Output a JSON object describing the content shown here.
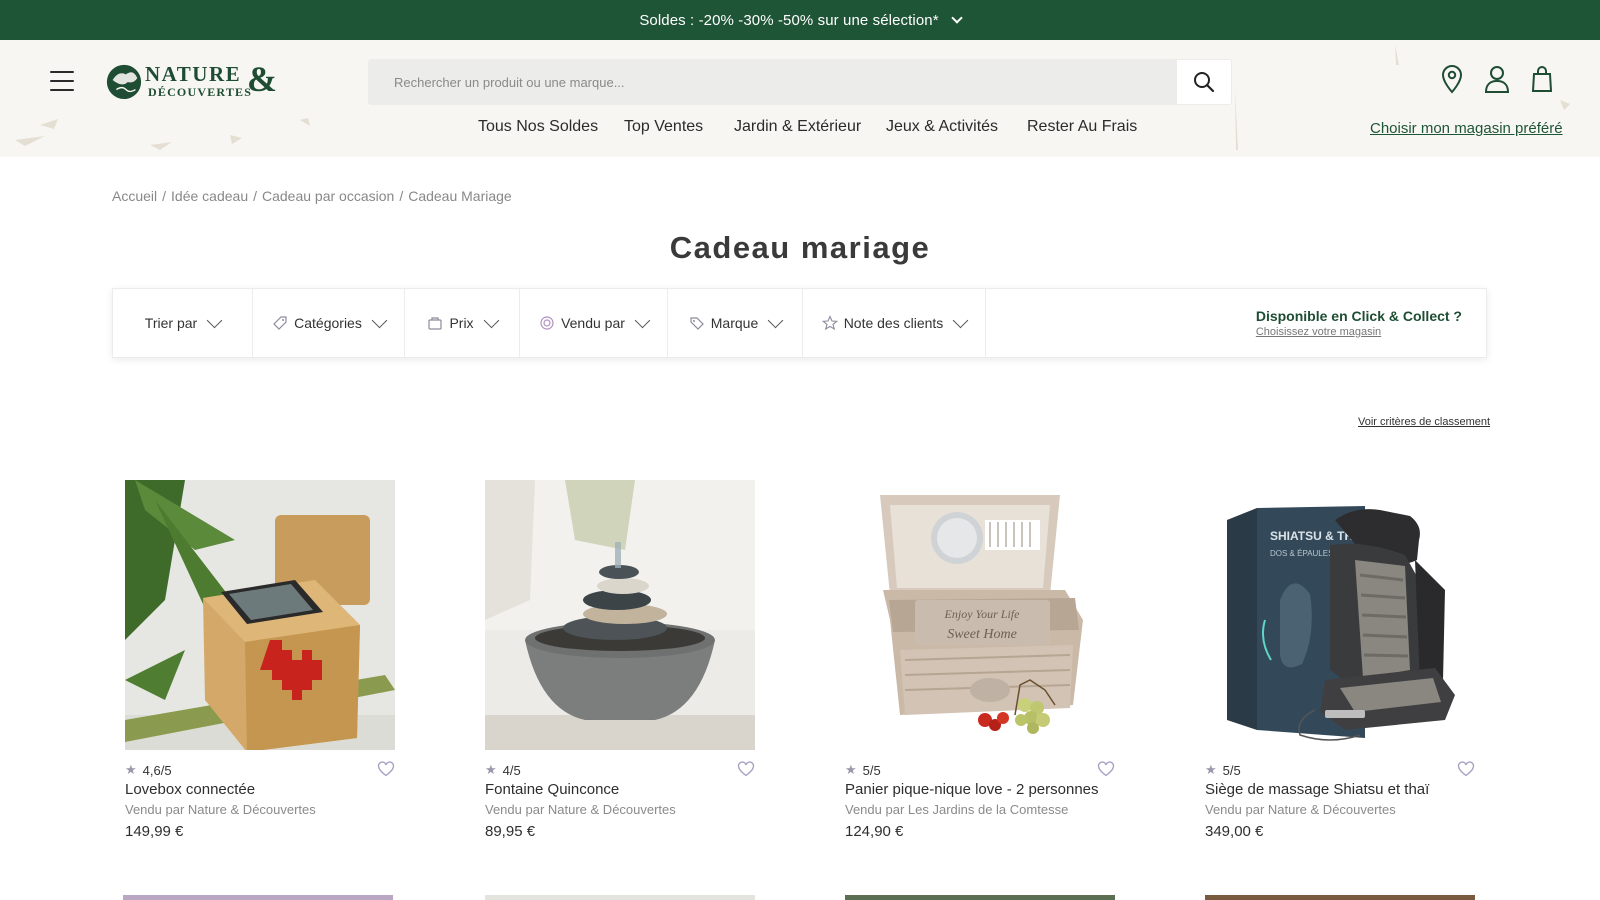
{
  "promo": {
    "text": "Soldes : -20% -30% -50% sur une sélection*"
  },
  "header": {
    "logo": {
      "line1": "NATURE",
      "line2": "DÉCOUVERTES",
      "amp": "&"
    },
    "search": {
      "placeholder": "Rechercher un produit ou une marque..."
    },
    "nav": [
      "Tous Nos Soldes",
      "Top Ventes",
      "Jardin & Extérieur",
      "Jeux & Activités",
      "Rester Au Frais"
    ],
    "icons": [
      "location-pin-icon",
      "account-icon",
      "cart-bag-icon"
    ],
    "store_link": "Choisir mon magasin préféré"
  },
  "breadcrumb": {
    "items": [
      "Accueil",
      "Idée cadeau",
      "Cadeau par occasion"
    ],
    "current": "Cadeau Mariage",
    "separator": "/"
  },
  "page": {
    "title": "Cadeau mariage"
  },
  "filters": {
    "items": [
      {
        "label": "Trier par",
        "icon": ""
      },
      {
        "label": "Catégories",
        "icon": "tag-icon"
      },
      {
        "label": "Prix",
        "icon": "price-bag-icon"
      },
      {
        "label": "Vendu par",
        "icon": "seller-icon"
      },
      {
        "label": "Marque",
        "icon": "label-icon"
      },
      {
        "label": "Note des clients",
        "icon": "star-outline-icon"
      }
    ],
    "click_collect": {
      "title": "Disponible en Click & Collect ?",
      "link": "Choisissez votre magasin"
    }
  },
  "criteria_link": "Voir critères de classement",
  "products": [
    {
      "rating": "4,6/5",
      "name": "Lovebox connectée",
      "seller": "Vendu par Nature & Découvertes",
      "price": "149,99 €"
    },
    {
      "rating": "4/5",
      "name": "Fontaine Quinconce",
      "seller": "Vendu par Nature & Découvertes",
      "price": "89,95 €"
    },
    {
      "rating": "5/5",
      "name": "Panier pique-nique love - 2 personnes",
      "seller": "Vendu par Les Jardins de la Comtesse",
      "price": "124,90 €"
    },
    {
      "rating": "5/5",
      "name": "Siège de massage Shiatsu et thaï",
      "seller": "Vendu par Nature & Découvertes",
      "price": "349,00 €"
    }
  ],
  "product_images": {
    "p3_text_line1": "Enjoy Your Life",
    "p3_text_line2": "Sweet Home",
    "p4_box_title": "SHIATSU & THAÏ",
    "p4_box_sub": "DOS & ÉPAULES"
  },
  "colors": {
    "brand_green": "#1f5537",
    "text": "#333333",
    "muted": "#8a8a8a",
    "star": "#9a97aa",
    "heart": "#a8a1c4"
  }
}
